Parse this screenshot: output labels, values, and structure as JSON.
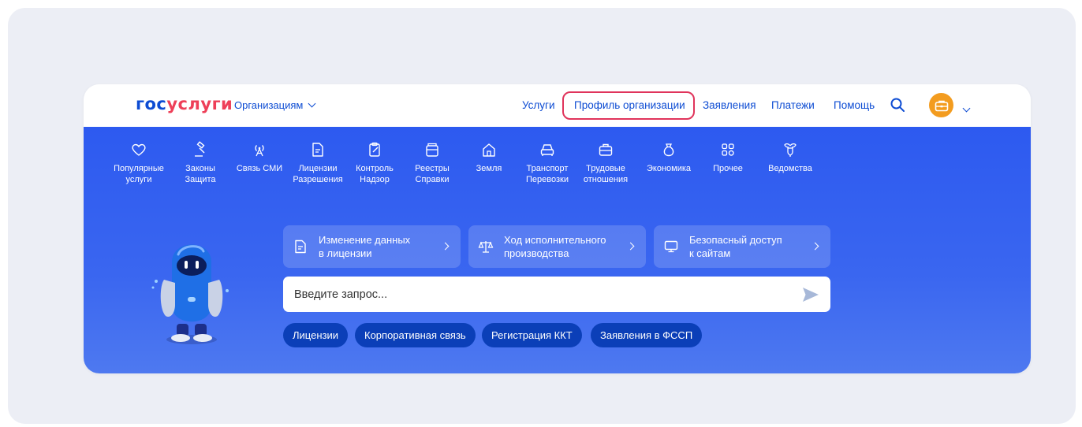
{
  "header": {
    "logo": {
      "part1": "гос",
      "part2": "услуги"
    },
    "org_menu": "Организациям",
    "nav": [
      "Услуги",
      "Профиль организации",
      "Заявления",
      "Платежи",
      "Помощь"
    ],
    "highlighted": "Профиль организации"
  },
  "categories": [
    {
      "icon": "heart-icon",
      "line1": "Популярные",
      "line2": "услуги"
    },
    {
      "icon": "gavel-icon",
      "line1": "Законы",
      "line2": "Защита"
    },
    {
      "icon": "antenna-icon",
      "line1": "Связь СМИ",
      "line2": ""
    },
    {
      "icon": "document-icon",
      "line1": "Лицензии",
      "line2": "Разрешения"
    },
    {
      "icon": "clipboard-icon",
      "line1": "Контроль",
      "line2": "Надзор"
    },
    {
      "icon": "registry-icon",
      "line1": "Реестры",
      "line2": "Справки"
    },
    {
      "icon": "house-icon",
      "line1": "Земля",
      "line2": ""
    },
    {
      "icon": "car-icon",
      "line1": "Транспорт",
      "line2": "Перевозки"
    },
    {
      "icon": "briefcase-icon",
      "line1": "Трудовые",
      "line2": "отношения"
    },
    {
      "icon": "money-bag-icon",
      "line1": "Экономика",
      "line2": ""
    },
    {
      "icon": "grid-icon",
      "line1": "Прочее",
      "line2": ""
    },
    {
      "icon": "eagle-icon",
      "line1": "Ведомства",
      "line2": ""
    }
  ],
  "quick_links": [
    {
      "icon": "document-icon",
      "line1": "Изменение данных",
      "line2": "в лицензии"
    },
    {
      "icon": "scales-icon",
      "line1": "Ход исполнительного",
      "line2": "производства"
    },
    {
      "icon": "monitor-icon",
      "line1": "Безопасный доступ",
      "line2": "к сайтам"
    }
  ],
  "search": {
    "placeholder": "Введите запрос..."
  },
  "chips": [
    "Лицензии",
    "Корпоративная связь",
    "Регистрация ККТ",
    "Заявления в ФССП"
  ],
  "colors": {
    "brand_blue": "#0d4cd3",
    "brand_red": "#ee3f58",
    "highlight": "#e0345b",
    "banner": "#2d5af0",
    "avatar": "#f39c1f"
  }
}
